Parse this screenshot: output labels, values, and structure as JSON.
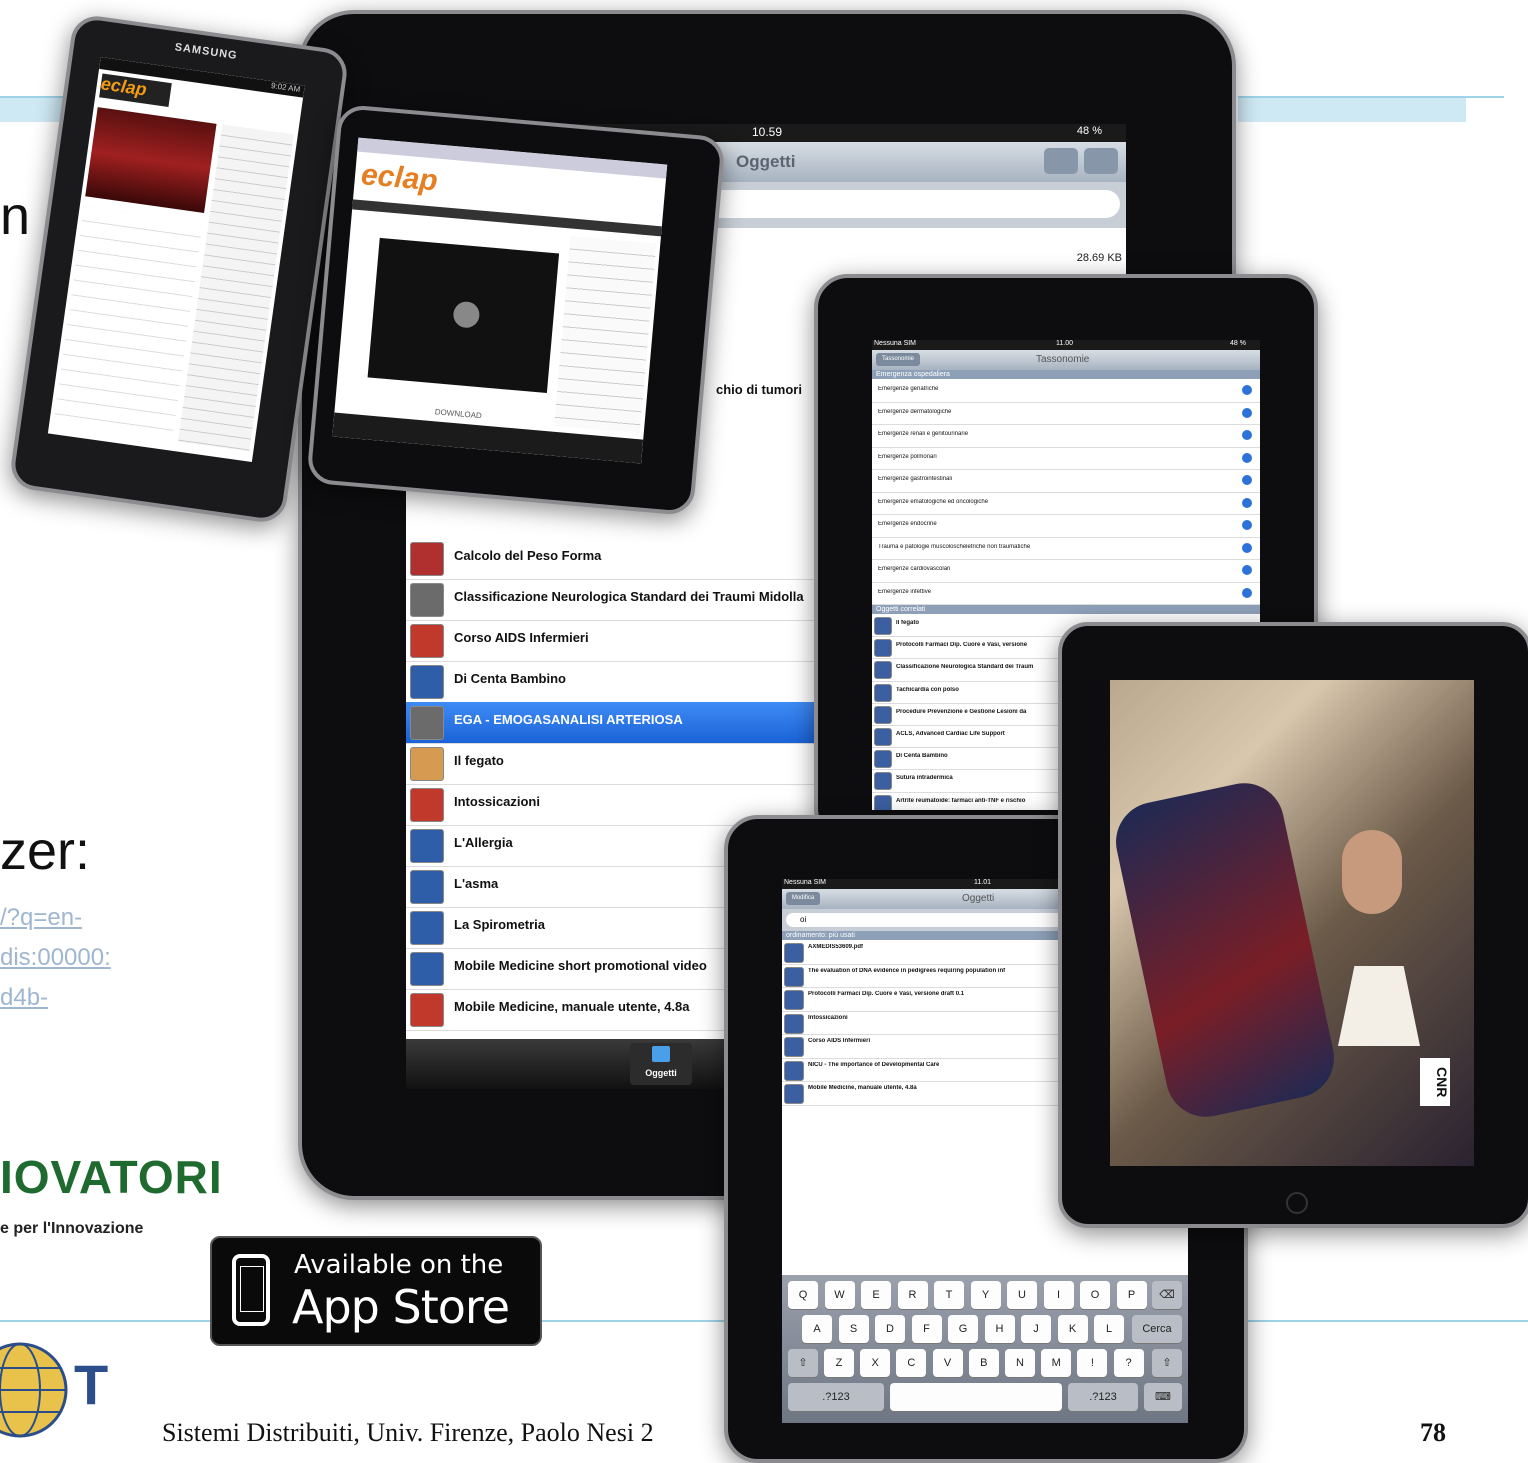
{
  "slide": {
    "text_fragment_1": "n",
    "text_fragment_2": "zer:",
    "link_fragments": [
      "/?q=en-",
      "dis:00000:",
      "d4b-"
    ],
    "partner_logo_text": "IOVATORI",
    "partner_logo_subtext": "e per l'Innovazione",
    "corner_logo_text": "T",
    "footer": "Sistemi Distribuiti, Univ. Firenze, Paolo Nesi 2",
    "page_number": "78"
  },
  "app_store_badge": {
    "line1": "Available on the",
    "line2": "App Store"
  },
  "samsung_tablet": {
    "brand": "SAMSUNG",
    "status_time": "9:02 AM",
    "site_logo": "eclap"
  },
  "eclap_tablet": {
    "site_logo": "eclap",
    "bottom_button": "DOWNLOAD"
  },
  "main_ipad": {
    "status_time": "10.59",
    "battery": "48 %",
    "nav_title": "Oggetti",
    "file_size": "28.69 KB",
    "partial_row": "chio di tumori",
    "rows": [
      {
        "label": "Calcolo del Peso Forma",
        "icon": "media-icon",
        "selected": false
      },
      {
        "label": "Classificazione Neurologica Standard dei Traumi Midolla",
        "icon": "axmedis-icon",
        "selected": false
      },
      {
        "label": "Corso AIDS Infermieri",
        "icon": "pdf-icon",
        "selected": false
      },
      {
        "label": "Di Centa Bambino",
        "icon": "video-icon",
        "selected": false
      },
      {
        "label": "EGA - EMOGASANALISI ARTERIOSA",
        "icon": "axmedis-icon",
        "selected": true
      },
      {
        "label": "Il fegato",
        "icon": "image-icon",
        "selected": false
      },
      {
        "label": "Intossicazioni",
        "icon": "pdf-icon",
        "selected": false
      },
      {
        "label": "L'Allergia",
        "icon": "video-icon",
        "selected": false
      },
      {
        "label": "L'asma",
        "icon": "video-icon",
        "selected": false
      },
      {
        "label": "La Spirometria",
        "icon": "video-icon",
        "selected": false
      },
      {
        "label": "Mobile Medicine short promotional video",
        "icon": "video-icon",
        "selected": false
      },
      {
        "label": "Mobile Medicine, manuale utente, 4.8a",
        "icon": "pdf-icon",
        "selected": false
      }
    ],
    "tab_label": "Oggetti"
  },
  "tassonomie_ipad": {
    "status_carrier": "Nessuna SIM",
    "status_time": "11.00",
    "status_battery": "48 %",
    "back_button": "Tassonomie",
    "nav_title": "Tassonomie",
    "section1": "Emergenza ospedaliera",
    "categories": [
      "Emergenze geriatriche",
      "Emergenze dermatologiche",
      "Emergenze renali e genitourinarie",
      "Emergenze polmonari",
      "Emergenze gastrointestinali",
      "Emergenze ematologiche ed oncologiche",
      "Emergenze endocrine",
      "Trauma e patologie muscoloscheletriche non traumatiche",
      "Emergenze cardiovascolari",
      "Emergenze infettive"
    ],
    "section2": "Oggetti correlati",
    "related": [
      "Il fegato",
      "Protocolli Farmaci Dip. Cuore e Vasi, versione",
      "Classificazione Neurologica Standard dei Traum",
      "Tachicardia con polso",
      "Procedure Prevenzione e Gestione Lesioni da",
      "ACLS, Advanced Cardiac Life Support",
      "Di Centa Bambino",
      "Sutura intradermica",
      "Artrite reumatoide: farmaci anti-TNF e rischio"
    ]
  },
  "search_ipad": {
    "status_carrier": "Nessuna SIM",
    "status_time": "11.01",
    "edit_button": "Modifica",
    "nav_title": "Oggetti",
    "search_value": "oi",
    "section": "ordinamento: più usati",
    "results": [
      "AXMEDIS53609.pdf",
      "The evaluation of DNA evidence in pedigrees requiring population inf",
      "Protocolli Farmaci Dip. Cuore e Vasi, versione draft 0.1",
      "Intossicazioni",
      "Corso AIDS Infermieri",
      "NICU - The importance of Developmental Care",
      "Mobile Medicine, manuale utente, 4.8a"
    ],
    "keyboard": {
      "row1": [
        "Q",
        "W",
        "E",
        "R",
        "T",
        "Y",
        "U",
        "I",
        "O",
        "P"
      ],
      "row2": [
        "A",
        "S",
        "D",
        "F",
        "G",
        "H",
        "J",
        "K",
        "L"
      ],
      "row3": [
        "Z",
        "X",
        "C",
        "V",
        "B",
        "N",
        "M",
        "!",
        "?"
      ],
      "search_key": "Cerca",
      "numbers_key": ".?123"
    }
  },
  "video_ipad": {
    "overlay_logo": "CNR"
  }
}
